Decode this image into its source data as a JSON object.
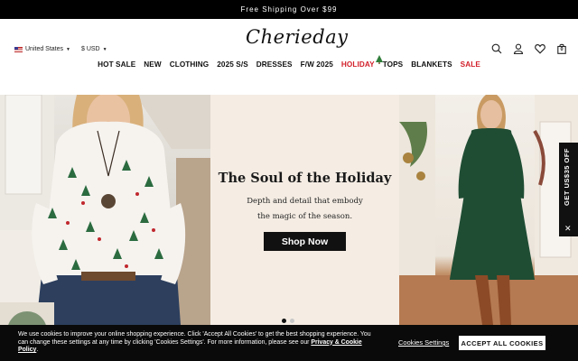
{
  "promo": {
    "text": "Free Shipping Over $99"
  },
  "header": {
    "country": "United States",
    "currency": "$ USD",
    "logo_text": "Cherieday"
  },
  "nav": [
    {
      "label": "HOT SALE",
      "color": "#111111"
    },
    {
      "label": "NEW",
      "color": "#111111"
    },
    {
      "label": "CLOTHING",
      "color": "#111111"
    },
    {
      "label": "2025 S/S",
      "color": "#111111"
    },
    {
      "label": "DRESSES",
      "color": "#111111"
    },
    {
      "label": "F/W 2025",
      "color": "#111111"
    },
    {
      "label": "HOLIDAY",
      "color": "#d21f2a",
      "icon": "christmas-tree-icon"
    },
    {
      "label": "TOPS",
      "color": "#111111"
    },
    {
      "label": "BLANKETS",
      "color": "#111111"
    },
    {
      "label": "SALE",
      "color": "#d21f2a"
    }
  ],
  "header_icons": [
    "search-icon",
    "account-icon",
    "wishlist-heart-icon",
    "cart-bag-icon"
  ],
  "cart": {
    "count": "0"
  },
  "hero": {
    "title": "The Soul of the Holiday",
    "subtitle_line1": "Depth and detail that embody",
    "subtitle_line2": "the magic of the season.",
    "cta": "Shop Now",
    "slides_total": 2,
    "active_slide": 1
  },
  "side_tab": {
    "text": "GET US$35 OFF"
  },
  "cookie": {
    "message": "We use cookies to improve your online shopping experience. Click 'Accept All Cookies' to get the best shopping experience. You can change these settings at any time by clicking 'Cookies Settings'. For more information, please see our ",
    "policy_link": "Privacy & Cookie Policy",
    "message_end": ".",
    "settings_label": "Cookies Settings",
    "accept_label": "ACCEPT ALL COOKIES"
  },
  "colors": {
    "accent_red": "#d21f2a",
    "dark": "#111111"
  }
}
